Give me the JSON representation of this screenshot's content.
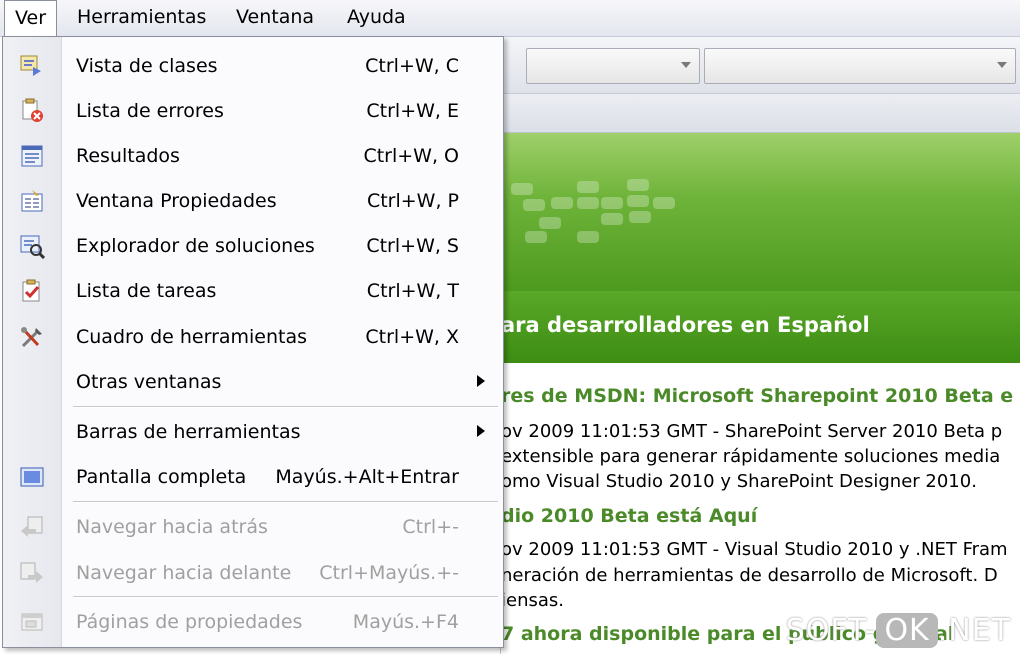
{
  "menubar": {
    "items": [
      {
        "label": "Ver",
        "active": true
      },
      {
        "label": "Herramientas"
      },
      {
        "label": "Ventana"
      },
      {
        "label": "Ayuda"
      }
    ]
  },
  "menu": {
    "items": [
      {
        "label": "Vista de clases",
        "shortcut": "Ctrl+W, C",
        "icon": "class-view-icon"
      },
      {
        "label": "Lista de errores",
        "shortcut": "Ctrl+W, E",
        "icon": "error-list-icon"
      },
      {
        "label": "Resultados",
        "shortcut": "Ctrl+W, O",
        "icon": "output-icon"
      },
      {
        "label": "Ventana Propiedades",
        "shortcut": "Ctrl+W, P",
        "icon": "properties-icon"
      },
      {
        "label": "Explorador de soluciones",
        "shortcut": "Ctrl+W, S",
        "icon": "solution-explorer-icon"
      },
      {
        "label": "Lista de tareas",
        "shortcut": "Ctrl+W, T",
        "icon": "task-list-icon"
      },
      {
        "label": "Cuadro de herramientas",
        "shortcut": "Ctrl+W, X",
        "icon": "toolbox-icon"
      },
      {
        "label": "Otras ventanas",
        "submenu": true
      },
      {
        "label": "Barras de herramientas",
        "submenu": true
      },
      {
        "label": "Pantalla completa",
        "shortcut": "Mayús.+Alt+Entrar",
        "icon": "full-screen-icon"
      },
      {
        "label": "Navegar hacia atrás",
        "shortcut": "Ctrl+-",
        "disabled": true,
        "icon": "navigate-back-icon"
      },
      {
        "label": "Navegar hacia delante",
        "shortcut": "Ctrl+Mayús.+-",
        "disabled": true,
        "icon": "navigate-forward-icon"
      },
      {
        "label": "Páginas de propiedades",
        "shortcut": "Mayús.+F4",
        "disabled": true,
        "icon": "property-pages-icon"
      }
    ]
  },
  "content": {
    "banner_text": "ara desarrolladores en Español",
    "lines": [
      "res de MSDN: Microsoft Sharepoint 2010 Beta e",
      "ov 2009 11:01:53 GMT - SharePoint Server 2010 Beta p",
      "extensible para generar rápidamente soluciones media",
      "omo Visual Studio 2010 y SharePoint Designer 2010.",
      "dio 2010 Beta está Aquí",
      "ov 2009 11:01:53 GMT - Visual Studio 2010 y .NET Fram",
      "neración de herramientas de desarrollo de Microsoft. D",
      "iensas.",
      "7 ahora disponible para el público general"
    ]
  },
  "watermark": {
    "left": "SOFT-",
    "ok": "OK",
    "right": ".NET"
  },
  "colors": {
    "accent_green": "#4d9a1f",
    "news_title": "#4b8a28"
  }
}
